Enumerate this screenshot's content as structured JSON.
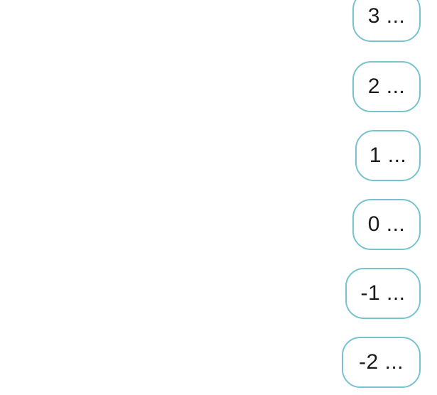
{
  "items": [
    {
      "label": "3 ..."
    },
    {
      "label": "2 ..."
    },
    {
      "label": "1 ..."
    },
    {
      "label": "0 ..."
    },
    {
      "label": "-1 ..."
    },
    {
      "label": "-2 ..."
    }
  ],
  "colors": {
    "pill_border": "#78c2ce",
    "text": "#1a1a1a",
    "background": "#ffffff"
  }
}
